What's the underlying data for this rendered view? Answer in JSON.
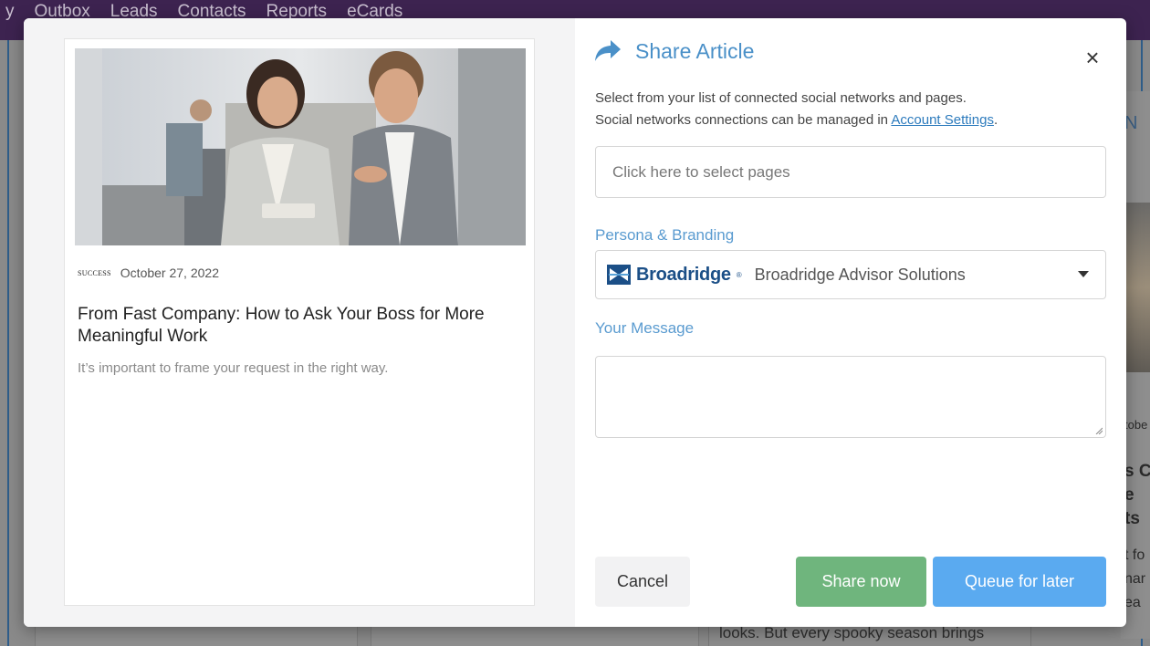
{
  "background": {
    "nav_items": [
      "y",
      "Outbox",
      "Leads",
      "Contacts",
      "Reports",
      "eCards"
    ],
    "right_fragments": [
      "N",
      "tobe",
      "s C",
      "e",
      "ts",
      "t fo",
      "nar",
      "ea"
    ],
    "bottom_text": "looks. But every spooky season brings"
  },
  "article": {
    "image_alt": "Two business people talking in an office, woman holding a tablet",
    "source_logo": "SUCCESS",
    "date": "October 27, 2022",
    "title": "From Fast Company: How to Ask Your Boss for More Meaningful Work",
    "summary": "It’s important to frame your request in the right way."
  },
  "share": {
    "title": "Share Article",
    "description_line1": "Select from your list of connected social networks and pages.",
    "description_line2_prefix": "Social networks connections can be managed in ",
    "account_settings_link": "Account Settings",
    "description_line2_suffix": ".",
    "pages_placeholder": "Click here to select pages",
    "persona_label": "Persona & Branding",
    "persona_brand_word": "Broadridge",
    "persona_value": "Broadridge Advisor Solutions",
    "message_label": "Your Message",
    "message_value": "",
    "cancel_label": "Cancel",
    "share_now_label": "Share now",
    "queue_label": "Queue for later",
    "close_glyph": "×"
  },
  "colors": {
    "accent": "#4a90c8",
    "share_now": "#6fb57d",
    "queue": "#5aaaf0",
    "brand_navy": "#1b4f87",
    "topbar": "#3d2350"
  },
  "icons": {
    "share": "share-arrow-icon",
    "close": "close-icon",
    "dropdown": "caret-down-icon",
    "brand": "broadridge-logo-icon"
  }
}
